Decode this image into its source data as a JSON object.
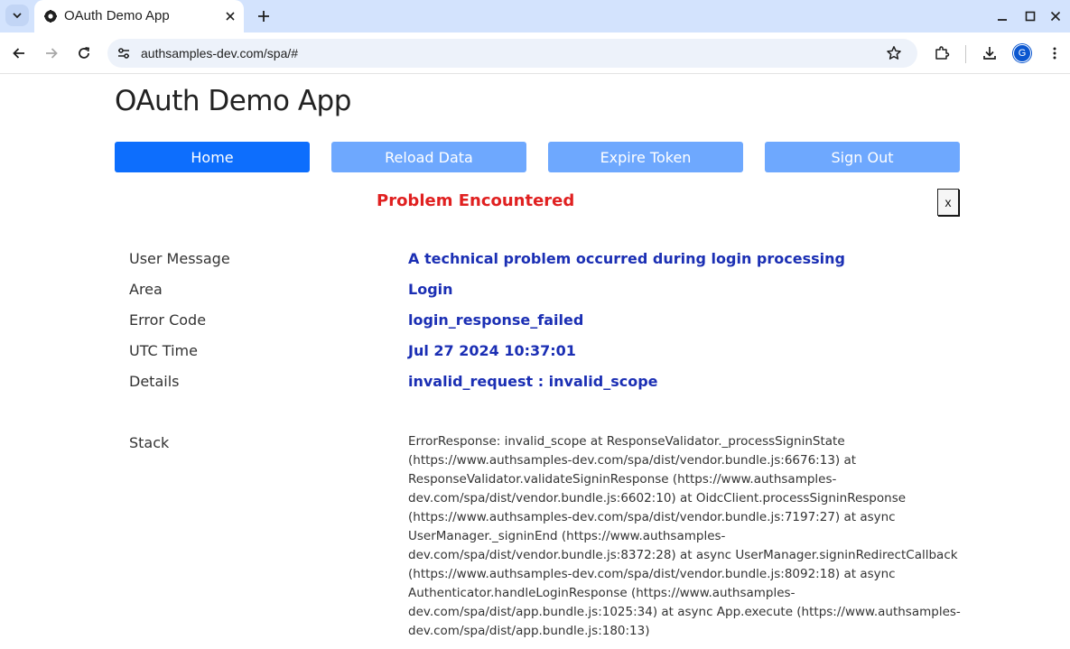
{
  "browser": {
    "tab_title": "OAuth Demo App",
    "url": "authsamples-dev.com/spa/#",
    "profile_initial": "G"
  },
  "app": {
    "title": "OAuth Demo App",
    "nav": {
      "home": "Home",
      "reload": "Reload Data",
      "expire": "Expire Token",
      "signout": "Sign Out"
    }
  },
  "error": {
    "title": "Problem Encountered",
    "close_label": "x",
    "fields": [
      {
        "label": "User Message",
        "value": "A technical problem occurred during login processing"
      },
      {
        "label": "Area",
        "value": "Login"
      },
      {
        "label": "Error Code",
        "value": "login_response_failed"
      },
      {
        "label": "UTC Time",
        "value": "Jul 27 2024 10:37:01"
      },
      {
        "label": "Details",
        "value": "invalid_request : invalid_scope"
      }
    ],
    "stack_label": "Stack",
    "stack_lines": [
      "ErrorResponse: invalid_scope at ResponseValidator._processSigninState",
      "(https://www.authsamples-dev.com/spa/dist/vendor.bundle.js:6676:13) at",
      "ResponseValidator.validateSigninResponse (https://www.authsamples-",
      "dev.com/spa/dist/vendor.bundle.js:6602:10) at OidcClient.processSigninResponse",
      "(https://www.authsamples-dev.com/spa/dist/vendor.bundle.js:7197:27) at async",
      "UserManager._signinEnd (https://www.authsamples-",
      "dev.com/spa/dist/vendor.bundle.js:8372:28) at async UserManager.signinRedirectCallback",
      "(https://www.authsamples-dev.com/spa/dist/vendor.bundle.js:8092:18) at async",
      "Authenticator.handleLoginResponse (https://www.authsamples-",
      "dev.com/spa/dist/app.bundle.js:1025:34) at async App.execute (https://www.authsamples-",
      "dev.com/spa/dist/app.bundle.js:180:13)"
    ]
  },
  "colors": {
    "primary": "#0d6efd",
    "primary_faded": "#6ea8fe",
    "error_title": "#e02020",
    "value_text": "#1b2fb4"
  }
}
